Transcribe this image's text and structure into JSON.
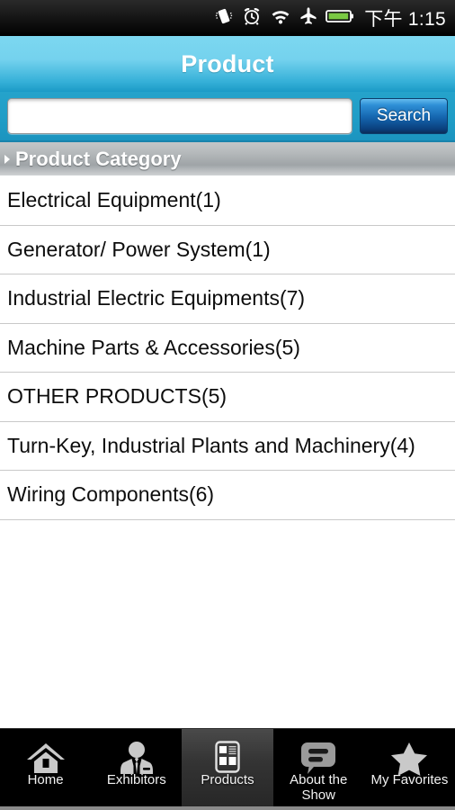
{
  "statusbar": {
    "time": "下午 1:15",
    "icons": [
      "vibrate-icon",
      "alarm-clock-icon",
      "wifi-icon",
      "airplane-mode-icon",
      "battery-icon"
    ]
  },
  "header": {
    "title": "Product"
  },
  "search": {
    "value": "",
    "placeholder": "",
    "button_label": "Search"
  },
  "section": {
    "title": "Product Category"
  },
  "categories": [
    {
      "label": "Electrical Equipment(1)"
    },
    {
      "label": "Generator/ Power System(1)"
    },
    {
      "label": "Industrial Electric Equipments(7)"
    },
    {
      "label": "Machine Parts & Accessories(5)"
    },
    {
      "label": "OTHER PRODUCTS(5)"
    },
    {
      "label": "Turn-Key, Industrial Plants and Machinery(4)"
    },
    {
      "label": "Wiring Components(6)"
    }
  ],
  "tabs": [
    {
      "label": "Home",
      "icon": "home-icon",
      "active": false
    },
    {
      "label": "Exhibitors",
      "icon": "exhibitors-person-icon",
      "active": false
    },
    {
      "label": "Products",
      "icon": "products-grid-icon",
      "active": true
    },
    {
      "label": "About the\nShow",
      "icon": "speech-bubble-icon",
      "active": false
    },
    {
      "label": "My Favorites",
      "icon": "star-icon",
      "active": false
    }
  ],
  "colors": {
    "header_top": "#7cd7f0",
    "header_bottom": "#1b9ac6",
    "search_bg": "#1f9cc6",
    "search_button": "#1464ad",
    "section_bar": "#b6babc",
    "tabbar_bg": "#000000",
    "tab_active_bg": "#343434",
    "battery_green": "#7ac943"
  }
}
